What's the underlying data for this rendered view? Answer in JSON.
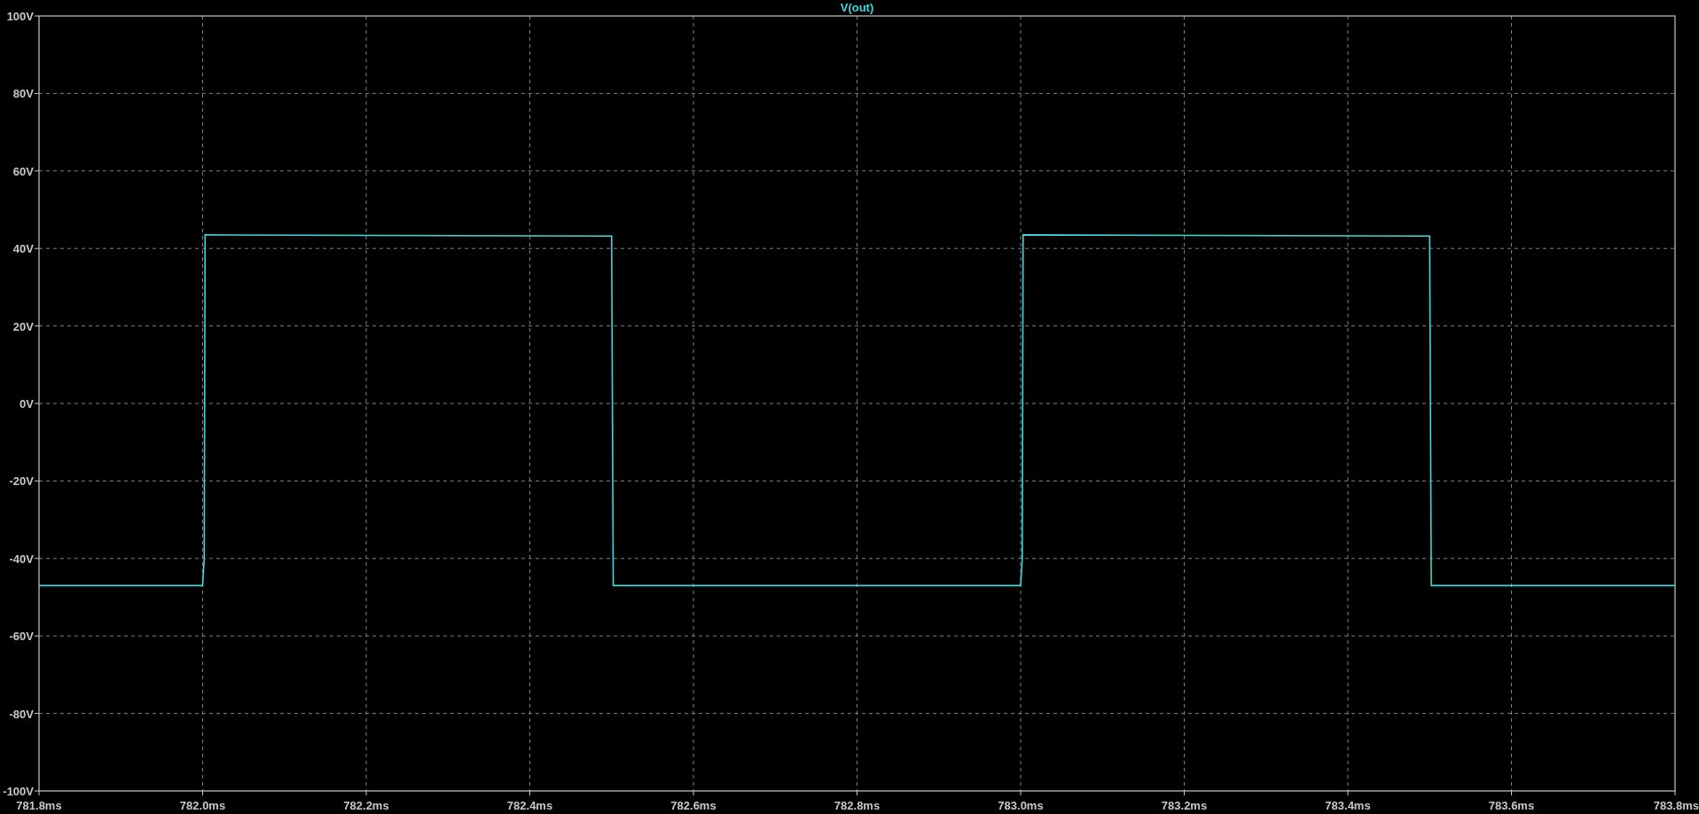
{
  "chart_data": {
    "type": "line",
    "grid": true,
    "xlim": [
      781.8,
      783.8
    ],
    "ylim": [
      -100,
      100
    ],
    "xticks": [
      {
        "value": 781.8,
        "label": "781.8ms"
      },
      {
        "value": 782.0,
        "label": "782.0ms"
      },
      {
        "value": 782.2,
        "label": "782.2ms"
      },
      {
        "value": 782.4,
        "label": "782.4ms"
      },
      {
        "value": 782.6,
        "label": "782.6ms"
      },
      {
        "value": 782.8,
        "label": "782.8ms"
      },
      {
        "value": 783.0,
        "label": "783.0ms"
      },
      {
        "value": 783.2,
        "label": "783.2ms"
      },
      {
        "value": 783.4,
        "label": "783.4ms"
      },
      {
        "value": 783.6,
        "label": "783.6ms"
      },
      {
        "value": 783.8,
        "label": "783.8ms"
      }
    ],
    "yticks": [
      {
        "value": 100,
        "label": "100V"
      },
      {
        "value": 80,
        "label": "80V"
      },
      {
        "value": 60,
        "label": "60V"
      },
      {
        "value": 40,
        "label": "40V"
      },
      {
        "value": 20,
        "label": "20V"
      },
      {
        "value": 0,
        "label": "0V"
      },
      {
        "value": -20,
        "label": "-20V"
      },
      {
        "value": -40,
        "label": "-40V"
      },
      {
        "value": -60,
        "label": "-60V"
      },
      {
        "value": -80,
        "label": "-80V"
      },
      {
        "value": -100,
        "label": "-100V"
      }
    ],
    "x": [
      781.8,
      782.0,
      782.002,
      782.003,
      782.5,
      782.5,
      782.502,
      783.0,
      783.002,
      783.003,
      783.5,
      783.5,
      783.502,
      783.8
    ],
    "series": [
      {
        "name": "V(out)",
        "color": "#40d8d8",
        "values": [
          -47,
          -47,
          -40,
          43.5,
          43.2,
          40,
          -47,
          -47,
          -40,
          43.5,
          43.2,
          40,
          -47,
          -47
        ]
      }
    ]
  }
}
